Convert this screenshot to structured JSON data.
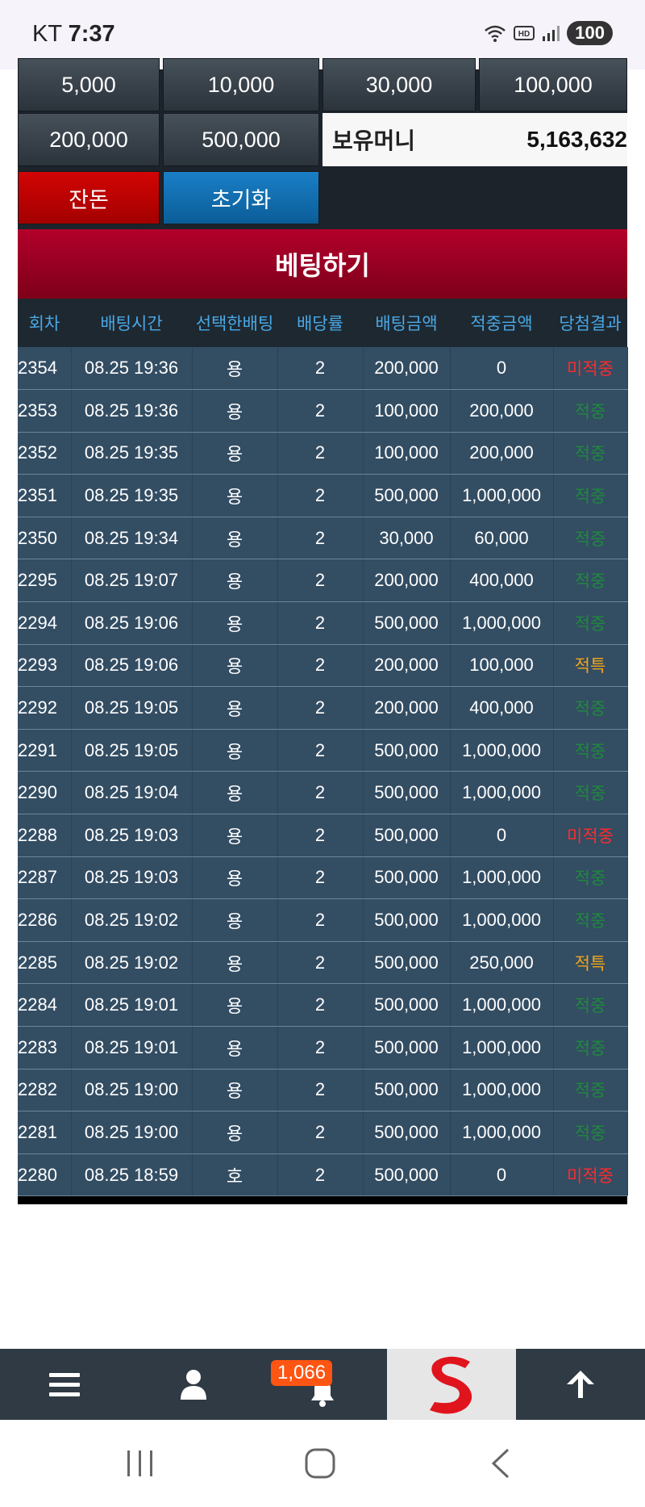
{
  "status_bar": {
    "carrier": "KT",
    "time": "7:37",
    "battery": "100"
  },
  "chips": {
    "row1": [
      "5,000",
      "10,000",
      "30,000",
      "100,000"
    ],
    "row2": [
      "200,000",
      "500,000"
    ],
    "balance_reset": "잔돈",
    "init": "초기화"
  },
  "money": {
    "label": "보유머니",
    "value": "5,163,632"
  },
  "bet_button": "베팅하기",
  "table": {
    "columns": [
      "회차",
      "배팅시간",
      "선택한배팅",
      "배당률",
      "배팅금액",
      "적중금액",
      "당첨결과"
    ],
    "rows": [
      [
        "2354",
        "08.25 19:36",
        "용",
        "2",
        "200,000",
        "0",
        "미적중"
      ],
      [
        "2353",
        "08.25 19:36",
        "용",
        "2",
        "100,000",
        "200,000",
        "적중"
      ],
      [
        "2352",
        "08.25 19:35",
        "용",
        "2",
        "100,000",
        "200,000",
        "적중"
      ],
      [
        "2351",
        "08.25 19:35",
        "용",
        "2",
        "500,000",
        "1,000,000",
        "적중"
      ],
      [
        "2350",
        "08.25 19:34",
        "용",
        "2",
        "30,000",
        "60,000",
        "적중"
      ],
      [
        "2295",
        "08.25 19:07",
        "용",
        "2",
        "200,000",
        "400,000",
        "적중"
      ],
      [
        "2294",
        "08.25 19:06",
        "용",
        "2",
        "500,000",
        "1,000,000",
        "적중"
      ],
      [
        "2293",
        "08.25 19:06",
        "용",
        "2",
        "200,000",
        "100,000",
        "적특"
      ],
      [
        "2292",
        "08.25 19:05",
        "용",
        "2",
        "200,000",
        "400,000",
        "적중"
      ],
      [
        "2291",
        "08.25 19:05",
        "용",
        "2",
        "500,000",
        "1,000,000",
        "적중"
      ],
      [
        "2290",
        "08.25 19:04",
        "용",
        "2",
        "500,000",
        "1,000,000",
        "적중"
      ],
      [
        "2288",
        "08.25 19:03",
        "용",
        "2",
        "500,000",
        "0",
        "미적중"
      ],
      [
        "2287",
        "08.25 19:03",
        "용",
        "2",
        "500,000",
        "1,000,000",
        "적중"
      ],
      [
        "2286",
        "08.25 19:02",
        "용",
        "2",
        "500,000",
        "1,000,000",
        "적중"
      ],
      [
        "2285",
        "08.25 19:02",
        "용",
        "2",
        "500,000",
        "250,000",
        "적특"
      ],
      [
        "2284",
        "08.25 19:01",
        "용",
        "2",
        "500,000",
        "1,000,000",
        "적중"
      ],
      [
        "2283",
        "08.25 19:01",
        "용",
        "2",
        "500,000",
        "1,000,000",
        "적중"
      ],
      [
        "2282",
        "08.25 19:00",
        "용",
        "2",
        "500,000",
        "1,000,000",
        "적중"
      ],
      [
        "2281",
        "08.25 19:00",
        "용",
        "2",
        "500,000",
        "1,000,000",
        "적중"
      ],
      [
        "2280",
        "08.25 18:59",
        "호",
        "2",
        "500,000",
        "0",
        "미적중"
      ]
    ]
  },
  "bottom_nav": {
    "notification_count": "1,066"
  },
  "colors": {
    "miss": "#ff2b2b",
    "hit": "#1f8a3c",
    "special": "#f1a51a"
  }
}
